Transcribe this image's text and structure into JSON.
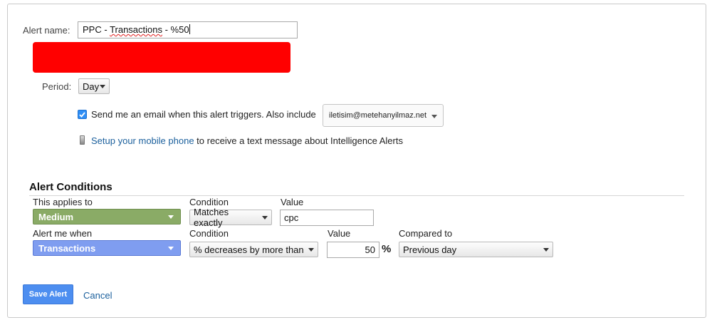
{
  "form": {
    "alert_name_label": "Alert name:",
    "alert_name_prefix": "PPC - ",
    "alert_name_misspelled": "Transactions",
    "alert_name_suffix": " - %50",
    "period_label": "Period:",
    "period_value": "Day",
    "email_checked": true,
    "email_text": "Send me an email when this alert triggers. Also include",
    "email_recipient": "iletisim@metehanyilmaz.net",
    "mobile_link": "Setup your mobile phone",
    "mobile_text": "to receive a text message about Intelligence Alerts"
  },
  "conditions": {
    "title": "Alert Conditions",
    "row1": {
      "applies_label": "This applies to",
      "dimension": "Medium",
      "condition_label": "Condition",
      "condition": "Matches exactly",
      "value_label": "Value",
      "value": "cpc"
    },
    "row2": {
      "alert_label": "Alert me when",
      "metric": "Transactions",
      "condition_label": "Condition",
      "condition": "% decreases by more than",
      "value_label": "Value",
      "value": "50",
      "unit": "%",
      "compared_label": "Compared to",
      "compared": "Previous day"
    }
  },
  "actions": {
    "save": "Save Alert",
    "cancel": "Cancel"
  },
  "colors": {
    "redaction": "#ff0000",
    "medium_select": "#8aab66",
    "metric_select": "#7f9df0",
    "save_button": "#4d8ef0",
    "link": "#1a5f9c"
  },
  "icons": {
    "checkbox": "checkmark-icon",
    "phone": "mobile-phone-icon"
  }
}
